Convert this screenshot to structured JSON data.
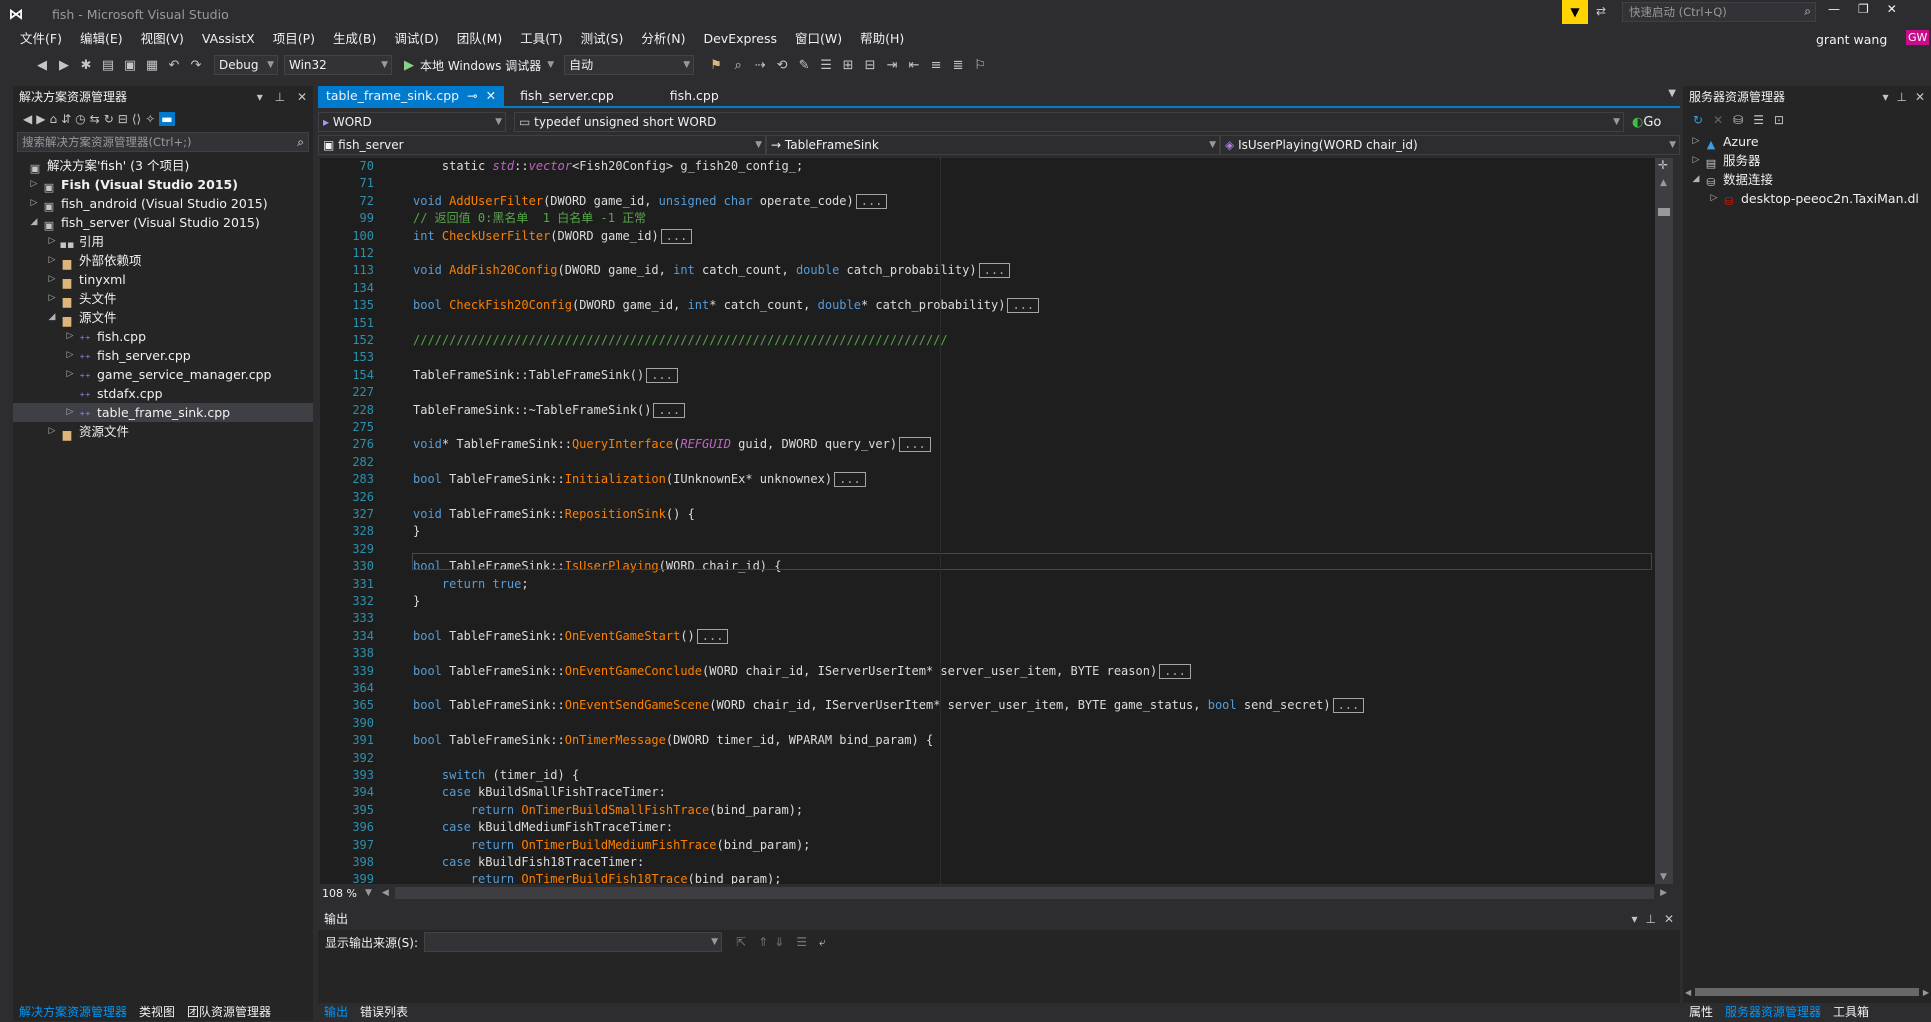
{
  "title": {
    "app": "fish - Microsoft Visual Studio",
    "quick_launch": "快速启动 (Ctrl+Q)",
    "user": "grant wang",
    "initials": "GW"
  },
  "menu": [
    "文件(F)",
    "编辑(E)",
    "视图(V)",
    "VAssistX",
    "项目(P)",
    "生成(B)",
    "调试(D)",
    "团队(M)",
    "工具(T)",
    "测试(S)",
    "分析(N)",
    "DevExpress",
    "窗口(W)",
    "帮助(H)"
  ],
  "toolbar": {
    "config": "Debug",
    "platform": "Win32",
    "run": "本地 Windows 调试器",
    "run_mode": "自动"
  },
  "solution": {
    "header": "解决方案资源管理器",
    "search_placeholder": "搜索解决方案资源管理器(Ctrl+;)",
    "items": [
      {
        "label": "解决方案'fish' (3 个项目)",
        "bold": false
      },
      {
        "label": "Fish (Visual Studio 2015)",
        "bold": true
      },
      {
        "label": "fish_android (Visual Studio 2015)",
        "bold": false
      },
      {
        "label": "fish_server (Visual Studio 2015)",
        "bold": false
      },
      {
        "label": "引用",
        "bold": false
      },
      {
        "label": "外部依赖项",
        "bold": false
      },
      {
        "label": "tinyxml",
        "bold": false
      },
      {
        "label": "头文件",
        "bold": false
      },
      {
        "label": "源文件",
        "bold": false
      },
      {
        "label": "fish.cpp",
        "bold": false
      },
      {
        "label": "fish_server.cpp",
        "bold": false
      },
      {
        "label": "game_service_manager.cpp",
        "bold": false
      },
      {
        "label": "stdafx.cpp",
        "bold": false
      },
      {
        "label": "table_frame_sink.cpp",
        "bold": false
      },
      {
        "label": "资源文件",
        "bold": false
      }
    ],
    "bottom_tabs": [
      "解决方案资源管理器",
      "类视图",
      "团队资源管理器"
    ]
  },
  "tabs": [
    {
      "label": "table_frame_sink.cpp"
    },
    {
      "label": "fish_server.cpp"
    },
    {
      "label": "fish.cpp"
    }
  ],
  "nav": {
    "type": "WORD",
    "typedef": "typedef unsigned short WORD",
    "go": "Go",
    "project": "fish_server",
    "class": "TableFrameSink",
    "member": "IsUserPlaying(WORD chair_id)"
  },
  "code": [
    {
      "n": "70",
      "html": "    static <span class=\"ma\">std</span>::<span class=\"ma\">vector</span>&lt;Fish20Config&gt; g_fish20_config_;"
    },
    {
      "n": "71",
      "html": ""
    },
    {
      "n": "72",
      "html": "<span class=\"kw\">void</span> <span class=\"fn\">AddUserFilter</span>(DWORD game_id, <span class=\"kw\">unsigned char</span> operate_code)<span class=\"fold\">...</span>"
    },
    {
      "n": "99",
      "html": "<span class=\"cm\">// 返回值 0:黑名单  1 白名单 -1 正常</span>"
    },
    {
      "n": "100",
      "html": "<span class=\"kw\">int</span> <span class=\"fn\">CheckUserFilter</span>(DWORD game_id)<span class=\"fold\">...</span>"
    },
    {
      "n": "112",
      "html": ""
    },
    {
      "n": "113",
      "html": "<span class=\"kw\">void</span> <span class=\"fn\">AddFish20Config</span>(DWORD game_id, <span class=\"kw\">int</span> catch_count, <span class=\"kw\">double</span> catch_probability)<span class=\"fold\">...</span>"
    },
    {
      "n": "134",
      "html": ""
    },
    {
      "n": "135",
      "html": "<span class=\"kw\">bool</span> <span class=\"fn\">CheckFish20Config</span>(DWORD game_id, <span class=\"kw\">int</span>* catch_count, <span class=\"kw\">double</span>* catch_probability)<span class=\"fold\">...</span>"
    },
    {
      "n": "151",
      "html": ""
    },
    {
      "n": "152",
      "html": "<span class=\"cm\">//////////////////////////////////////////////////////////////////////////</span>"
    },
    {
      "n": "153",
      "html": ""
    },
    {
      "n": "154",
      "html": "TableFrameSink::TableFrameSink()<span class=\"fold\">...</span>"
    },
    {
      "n": "227",
      "html": ""
    },
    {
      "n": "228",
      "html": "TableFrameSink::~TableFrameSink()<span class=\"fold\">...</span>"
    },
    {
      "n": "275",
      "html": ""
    },
    {
      "n": "276",
      "html": "<span class=\"kw\">void</span>* TableFrameSink::<span class=\"fn\">QueryInterface</span>(<span class=\"ma\">REFGUID</span> guid, DWORD query_ver)<span class=\"fold\">...</span>"
    },
    {
      "n": "282",
      "html": ""
    },
    {
      "n": "283",
      "html": "<span class=\"kw\">bool</span> TableFrameSink::<span class=\"fn\">Initialization</span>(IUnknownEx* unknownex)<span class=\"fold\">...</span>"
    },
    {
      "n": "326",
      "html": ""
    },
    {
      "n": "327",
      "html": "<span class=\"kw\">void</span> TableFrameSink::<span class=\"fn\">RepositionSink</span>() {"
    },
    {
      "n": "328",
      "html": "}"
    },
    {
      "n": "329",
      "html": ""
    },
    {
      "n": "330",
      "html": "<span class=\"kw\">bool</span> TableFrameSink::<span class=\"fn\">IsUserPlaying</span>(WORD chair_id) {"
    },
    {
      "n": "331",
      "html": "    <span class=\"kw\">return true</span>;"
    },
    {
      "n": "332",
      "html": "}"
    },
    {
      "n": "333",
      "html": ""
    },
    {
      "n": "334",
      "html": "<span class=\"kw\">bool</span> TableFrameSink::<span class=\"fn\">OnEventGameStart</span>()<span class=\"fold\">...</span>"
    },
    {
      "n": "338",
      "html": ""
    },
    {
      "n": "339",
      "html": "<span class=\"kw\">bool</span> TableFrameSink::<span class=\"fn\">OnEventGameConclude</span>(WORD chair_id, IServerUserItem* server_user_item, BYTE reason)<span class=\"fold\">...</span>"
    },
    {
      "n": "364",
      "html": ""
    },
    {
      "n": "365",
      "html": "<span class=\"kw\">bool</span> TableFrameSink::<span class=\"fn\">OnEventSendGameScene</span>(WORD chair_id, IServerUserItem* server_user_item, BYTE game_status, <span class=\"kw\">bool</span> send_secret)<span class=\"fold\">...</span>"
    },
    {
      "n": "390",
      "html": ""
    },
    {
      "n": "391",
      "html": "<span class=\"kw\">bool</span> TableFrameSink::<span class=\"fn\">OnTimerMessage</span>(DWORD timer_id, WPARAM bind_param) {"
    },
    {
      "n": "392",
      "html": ""
    },
    {
      "n": "393",
      "html": "    <span class=\"kw\">switch</span> (timer_id) {"
    },
    {
      "n": "394",
      "html": "    <span class=\"kw\">case</span> kBuildSmallFishTraceTimer:"
    },
    {
      "n": "395",
      "html": "        <span class=\"kw\">return</span> <span class=\"fn\">OnTimerBuildSmallFishTrace</span>(bind_param);"
    },
    {
      "n": "396",
      "html": "    <span class=\"kw\">case</span> kBuildMediumFishTraceTimer:"
    },
    {
      "n": "397",
      "html": "        <span class=\"kw\">return</span> <span class=\"fn\">OnTimerBuildMediumFishTrace</span>(bind_param);"
    },
    {
      "n": "398",
      "html": "    <span class=\"kw\">case</span> kBuildFish18TraceTimer:"
    },
    {
      "n": "399",
      "html": "        <span class=\"kw\">return</span> <span class=\"fn\">OnTimerBuildFish18Trace</span>(bind_param);"
    }
  ],
  "zoom": "108 %",
  "output": {
    "header": "输出",
    "source_label": "显示输出来源(S):",
    "bottom_tabs": [
      "输出",
      "错误列表"
    ]
  },
  "server": {
    "header": "服务器资源管理器",
    "items": [
      "Azure",
      "服务器",
      "数据连接",
      "desktop-peeoc2n.TaxiMan.dl"
    ],
    "bottom_tabs": [
      "属性",
      "服务器资源管理器",
      "工具箱"
    ]
  }
}
